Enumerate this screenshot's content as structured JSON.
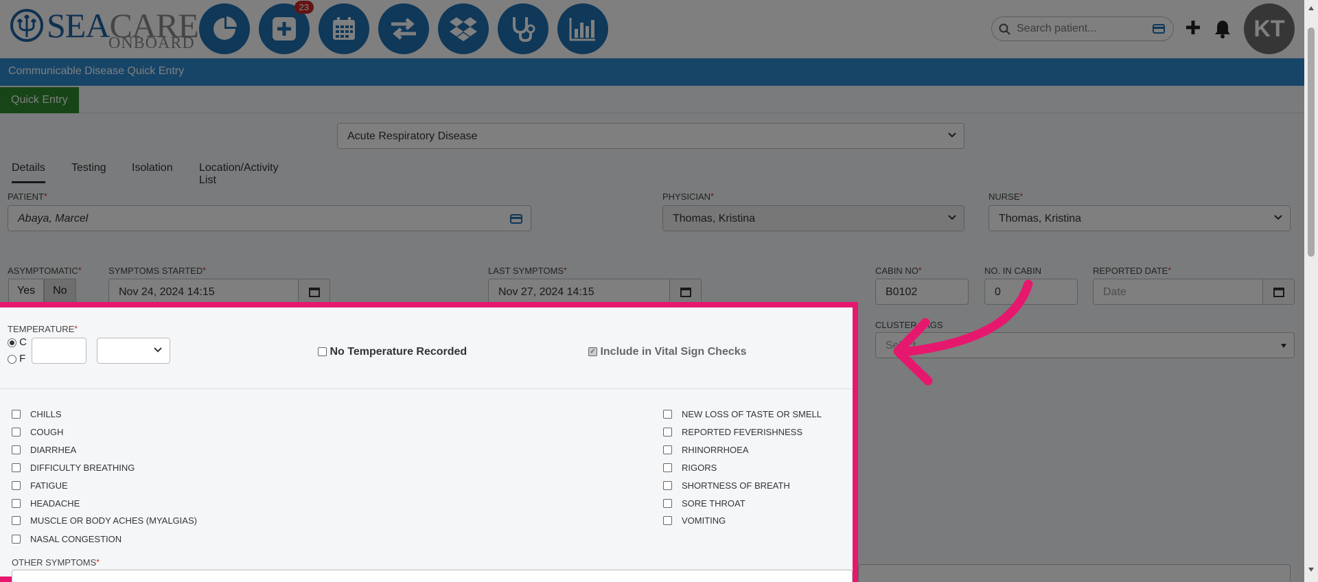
{
  "brand": {
    "sea": "SEA",
    "care": "CARE",
    "onboard": "ONBOARD"
  },
  "nav": {
    "items": [
      {
        "name": "dashboard-pie-icon"
      },
      {
        "name": "add-visit-icon",
        "badge": "23"
      },
      {
        "name": "calendar-icon"
      },
      {
        "name": "transfer-arrows-icon"
      },
      {
        "name": "dropbox-icon"
      },
      {
        "name": "stethoscope-icon"
      },
      {
        "name": "reports-chart-icon"
      }
    ]
  },
  "search": {
    "placeholder": "Search patient..."
  },
  "user": {
    "initials": "KT"
  },
  "title_bar": "Communicable Disease Quick Entry",
  "quick_entry": "Quick Entry",
  "disease_select": "Acute Respiratory Disease",
  "tabs": [
    "Details",
    "Testing",
    "Isolation",
    "Location/Activity List"
  ],
  "fields": {
    "patient_label": "PATIENT",
    "patient_value": "Abaya, Marcel",
    "physician_label": "PHYSICIAN",
    "physician_value": "Thomas, Kristina",
    "nurse_label": "NURSE",
    "nurse_value": "Thomas, Kristina",
    "asymptomatic_label": "ASYMPTOMATIC",
    "yes": "Yes",
    "no": "No",
    "symptoms_started_label": "SYMPTOMS STARTED",
    "symptoms_started_value": "Nov 24, 2024 14:15",
    "last_symptoms_label": "LAST SYMPTOMS",
    "last_symptoms_value": "Nov 27, 2024 14:15",
    "cabin_no_label": "CABIN NO",
    "cabin_no_value": "B0102",
    "no_in_cabin_label": "NO. IN CABIN",
    "no_in_cabin_value": "0",
    "reported_date_label": "REPORTED DATE",
    "reported_date_placeholder": "Date",
    "cluster_tags_label": "CLUSTER TAGS",
    "cluster_tags_placeholder": "Select..."
  },
  "temperature": {
    "label": "TEMPERATURE",
    "unit_c": "C",
    "unit_f": "F",
    "no_temp": "No Temperature Recorded",
    "include_vitals": "Include in Vital Sign Checks"
  },
  "symptoms_left": [
    "CHILLS",
    "COUGH",
    "DIARRHEA",
    "DIFFICULTY BREATHING",
    "FATIGUE",
    "HEADACHE",
    "MUSCLE OR BODY ACHES (MYALGIAS)",
    "NASAL CONGESTION"
  ],
  "symptoms_right": [
    "NEW LOSS OF TASTE OR SMELL",
    "REPORTED FEVERISHNESS",
    "RHINORRHOEA",
    "RIGORS",
    "SHORTNESS OF BREATH",
    "SORE THROAT",
    "VOMITING"
  ],
  "other_symptoms_label": "OTHER SYMPTOMS",
  "colors": {
    "accent": "#1f70b3",
    "titlebar": "#2f8bd0",
    "highlight": "#e6186e",
    "quick_entry": "#2e8b2e",
    "required": "#c62828"
  }
}
